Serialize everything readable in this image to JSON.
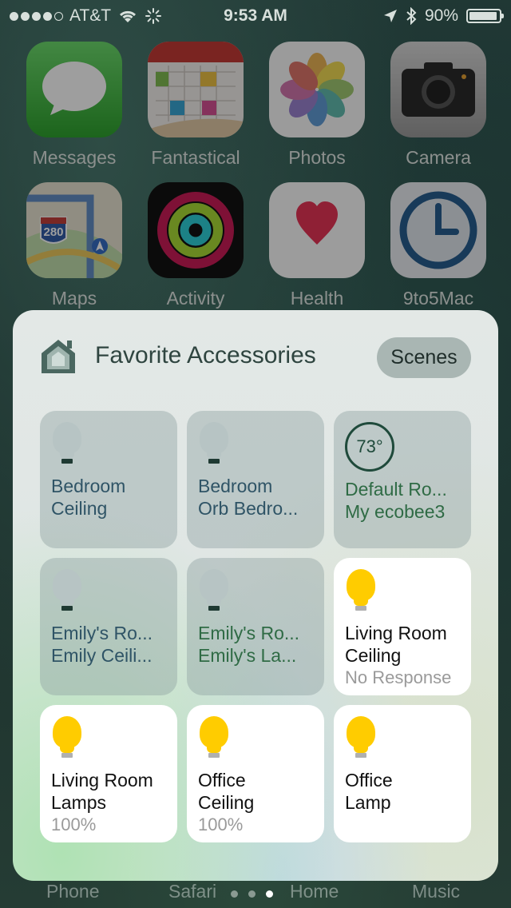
{
  "status_bar": {
    "carrier": "AT&T",
    "time": "9:53 AM",
    "battery": "90%",
    "signal_icons": [
      "signal-dots-icon",
      "wifi-icon",
      "activity-spinner-icon",
      "location-arrow-icon",
      "bluetooth-icon",
      "battery-icon"
    ]
  },
  "home_apps": [
    {
      "label": "Messages",
      "icon": "messages-icon"
    },
    {
      "label": "Fantastical",
      "icon": "calendar-icon"
    },
    {
      "label": "Photos",
      "icon": "photos-flower-icon"
    },
    {
      "label": "Camera",
      "icon": "camera-icon"
    },
    {
      "label": "Maps",
      "icon": "map-icon",
      "badge": "280"
    },
    {
      "label": "Activity",
      "icon": "activity-rings-icon"
    },
    {
      "label": "Health",
      "icon": "heart-icon"
    },
    {
      "label": "9to5Mac",
      "icon": "clock-icon"
    }
  ],
  "widget": {
    "title": "Favorite Accessories",
    "scenes_label": "Scenes",
    "tiles": [
      {
        "line1": "Bedroom",
        "line2": "Ceiling",
        "state": "off",
        "icon": "lightbulb-icon"
      },
      {
        "line1": "Bedroom",
        "line2": "Orb Bedro...",
        "state": "off",
        "icon": "lightbulb-icon"
      },
      {
        "line1": "Default Ro...",
        "line2": "My ecobee3",
        "state": "off",
        "icon": "thermostat-icon",
        "temperature": "73°"
      },
      {
        "line1": "Emily's Ro...",
        "line2": "Emily Ceili...",
        "state": "off",
        "icon": "lightbulb-icon"
      },
      {
        "line1": "Emily's Ro...",
        "line2": "Emily's La...",
        "state": "off",
        "icon": "lightbulb-icon"
      },
      {
        "line1": "Living Room",
        "line2": "Ceiling",
        "line3": "No Response",
        "state": "on",
        "icon": "lightbulb-icon"
      },
      {
        "line1": "Living Room",
        "line2": "Lamps",
        "line3": "100%",
        "state": "on",
        "icon": "lightbulb-icon"
      },
      {
        "line1": "Office",
        "line2": "Ceiling",
        "line3": "100%",
        "state": "on",
        "icon": "lightbulb-icon"
      },
      {
        "line1": "Office",
        "line2": "Lamp",
        "state": "on",
        "icon": "lightbulb-icon"
      }
    ]
  },
  "dock": {
    "items": [
      "Phone",
      "Safari",
      "Home",
      "Music"
    ],
    "page_count": 3,
    "active_page": 3
  },
  "colors": {
    "bulb_on": "#ffcc00",
    "tile_on_bg": "#ffffff",
    "tile_off_text": "#2f5466",
    "tile_off_green_text": "#2f6b45",
    "messages_green": "#3ccb3c"
  }
}
